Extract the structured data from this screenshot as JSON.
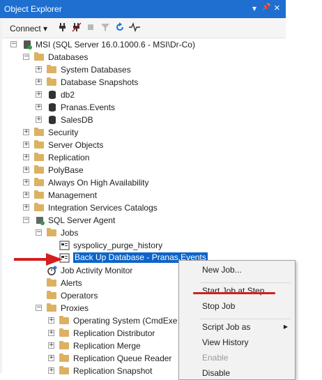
{
  "panel": {
    "title": "Object Explorer",
    "buttons": {
      "dropdown": "▾",
      "pin": "📌",
      "close": "×"
    }
  },
  "toolbar": {
    "connect_label": "Connect ▾"
  },
  "tree": [
    {
      "label": "MSI (SQL Server 16.0.1000.6 - MSI\\Dr-Co)",
      "depth": 0,
      "expander": "−",
      "icon": "server-icon"
    },
    {
      "label": "Databases",
      "depth": 1,
      "expander": "−",
      "icon": "folder-icon"
    },
    {
      "label": "System Databases",
      "depth": 2,
      "expander": "+",
      "icon": "folder-icon"
    },
    {
      "label": "Database Snapshots",
      "depth": 2,
      "expander": "+",
      "icon": "folder-icon"
    },
    {
      "label": "db2",
      "depth": 2,
      "expander": "+",
      "icon": "database-icon"
    },
    {
      "label": "Pranas.Events",
      "depth": 2,
      "expander": "+",
      "icon": "database-icon"
    },
    {
      "label": "SalesDB",
      "depth": 2,
      "expander": "+",
      "icon": "database-icon"
    },
    {
      "label": "Security",
      "depth": 1,
      "expander": "+",
      "icon": "folder-icon"
    },
    {
      "label": "Server Objects",
      "depth": 1,
      "expander": "+",
      "icon": "folder-icon"
    },
    {
      "label": "Replication",
      "depth": 1,
      "expander": "+",
      "icon": "folder-icon"
    },
    {
      "label": "PolyBase",
      "depth": 1,
      "expander": "+",
      "icon": "folder-icon"
    },
    {
      "label": "Always On High Availability",
      "depth": 1,
      "expander": "+",
      "icon": "folder-icon"
    },
    {
      "label": "Management",
      "depth": 1,
      "expander": "+",
      "icon": "folder-icon"
    },
    {
      "label": "Integration Services Catalogs",
      "depth": 1,
      "expander": "+",
      "icon": "folder-icon"
    },
    {
      "label": "SQL Server Agent",
      "depth": 1,
      "expander": "−",
      "icon": "agent-icon"
    },
    {
      "label": "Jobs",
      "depth": 2,
      "expander": "−",
      "icon": "folder-icon"
    },
    {
      "label": "syspolicy_purge_history",
      "depth": 3,
      "expander": "",
      "icon": "job-icon"
    },
    {
      "label": "Back Up Database - Pranas.Events",
      "depth": 3,
      "expander": "",
      "icon": "job-icon",
      "selected": true
    },
    {
      "label": "Job Activity Monitor",
      "depth": 2,
      "expander": "",
      "icon": "monitor-icon"
    },
    {
      "label": "Alerts",
      "depth": 2,
      "expander": "",
      "icon": "folder-icon"
    },
    {
      "label": "Operators",
      "depth": 2,
      "expander": "",
      "icon": "folder-icon"
    },
    {
      "label": "Proxies",
      "depth": 2,
      "expander": "−",
      "icon": "folder-icon"
    },
    {
      "label": "Operating System (CmdExe",
      "depth": 3,
      "expander": "+",
      "icon": "folder-icon"
    },
    {
      "label": "Replication Distributor",
      "depth": 3,
      "expander": "+",
      "icon": "folder-icon"
    },
    {
      "label": "Replication Merge",
      "depth": 3,
      "expander": "+",
      "icon": "folder-icon"
    },
    {
      "label": "Replication Queue Reader",
      "depth": 3,
      "expander": "+",
      "icon": "folder-icon"
    },
    {
      "label": "Replication Snapshot",
      "depth": 3,
      "expander": "+",
      "icon": "folder-icon"
    }
  ],
  "context_menu": [
    {
      "label": "New Job...",
      "enabled": true
    },
    {
      "separator": true
    },
    {
      "label": "Start Job at Step...",
      "enabled": true
    },
    {
      "label": "Stop Job",
      "enabled": true
    },
    {
      "separator": true
    },
    {
      "label": "Script Job as",
      "enabled": true,
      "submenu": true
    },
    {
      "label": "View History",
      "enabled": true
    },
    {
      "label": "Enable",
      "enabled": false
    },
    {
      "label": "Disable",
      "enabled": true
    }
  ],
  "colors": {
    "titlebar": "#1e6fd0",
    "selection": "#0c64c8",
    "folder": "#dcb162",
    "annotation": "#d21f1f"
  }
}
